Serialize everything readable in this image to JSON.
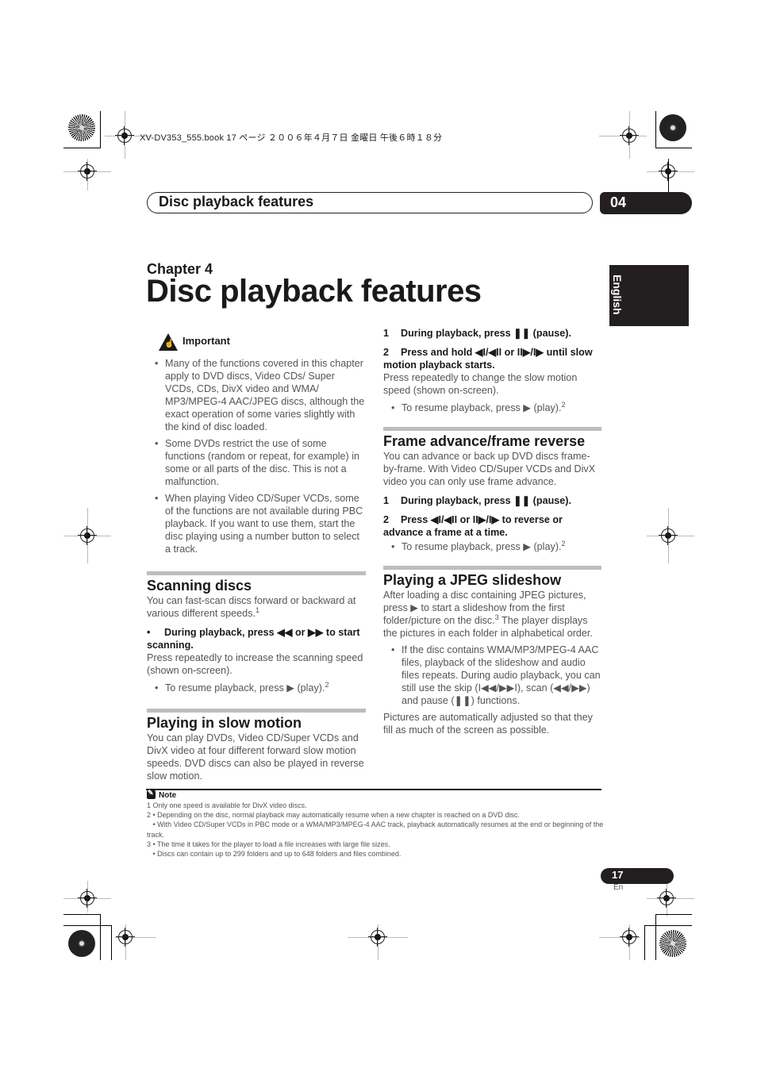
{
  "slug": "XV-DV353_555.book  17 ページ  ２００６年４月７日  金曜日  午後６時１８分",
  "header": {
    "title": "Disc playback features",
    "chapter_number": "04"
  },
  "language_tab": "English",
  "chapter": {
    "label": "Chapter 4",
    "title": "Disc playback features"
  },
  "important": {
    "label": "Important",
    "bullets": [
      "Many of the functions covered in this chapter apply to DVD discs, Video CDs/ Super VCDs, CDs, DivX video and WMA/ MP3/MPEG-4 AAC/JPEG discs, although the exact operation of some varies slightly with the kind of disc loaded.",
      "Some DVDs restrict the use of some functions (random or repeat, for example) in some or all parts of the disc. This is not a malfunction.",
      "When playing Video CD/Super VCDs, some of the functions are not available during PBC playback. If you want to use them, start the disc playing using a number button to select a track."
    ]
  },
  "scanning": {
    "title": "Scanning discs",
    "intro": "You can fast-scan discs forward or backward at various different speeds.",
    "intro_note": "1",
    "step_bullet": "•",
    "step": "During playback, press ◀◀ or ▶▶ to start scanning.",
    "step_desc": "Press repeatedly to increase the scanning speed (shown on-screen).",
    "resume": "To resume playback, press ▶ (play).",
    "resume_note": "2"
  },
  "slow_motion": {
    "title": "Playing in slow motion",
    "intro": "You can play DVDs, Video CD/Super VCDs and DivX video at four different forward slow motion speeds. DVD discs can also be played in reverse slow motion.",
    "steps": [
      {
        "num": "1",
        "text": "During playback, press ❚❚ (pause)."
      },
      {
        "num": "2",
        "text": "Press and hold ◀I/◀II or II▶/I▶ until slow motion playback starts."
      }
    ],
    "step_desc": "Press repeatedly to change the slow motion speed (shown on-screen).",
    "resume": "To resume playback, press ▶ (play).",
    "resume_note": "2"
  },
  "frame": {
    "title": "Frame advance/frame reverse",
    "intro": "You can advance or back up DVD discs frame-by-frame. With Video CD/Super VCDs and DivX video you can only use frame advance.",
    "steps": [
      {
        "num": "1",
        "text": "During playback, press ❚❚ (pause)."
      },
      {
        "num": "2",
        "text": "Press ◀I/◀II or II▶/I▶ to reverse or advance a frame at a time."
      }
    ],
    "resume": "To resume playback, press ▶ (play).",
    "resume_note": "2"
  },
  "jpeg": {
    "title": "Playing a JPEG slideshow",
    "intro_a": "After loading a disc containing JPEG pictures, press ▶ to start a slideshow from the first folder/picture on the disc.",
    "intro_note": "3",
    "intro_b": " The player displays the pictures in each folder in alphabetical order.",
    "bullet": "If the disc contains WMA/MP3/MPEG-4 AAC files, playback of the slideshow and audio files repeats. During audio playback, you can still use the skip (I◀◀/▶▶I), scan (◀◀/▶▶) and pause (❚❚) functions.",
    "outro": "Pictures are automatically adjusted so that they fill as much of the screen as possible."
  },
  "notes": {
    "label": "Note",
    "items": [
      "1 Only one speed is available for DivX video discs.",
      "2 • Depending on the disc, normal playback may automatically resume when a new chapter is reached on a DVD disc.",
      "   • With Video CD/Super VCDs in PBC mode or a WMA/MP3/MPEG-4 AAC track, playback automatically resumes at the end or beginning of the track.",
      "3 • The time it takes for the player to load a file increases with large file sizes.",
      "   • Discs can contain up to 299 folders and up to 648 folders and files combined."
    ]
  },
  "footer": {
    "page_number": "17",
    "language": "En"
  }
}
